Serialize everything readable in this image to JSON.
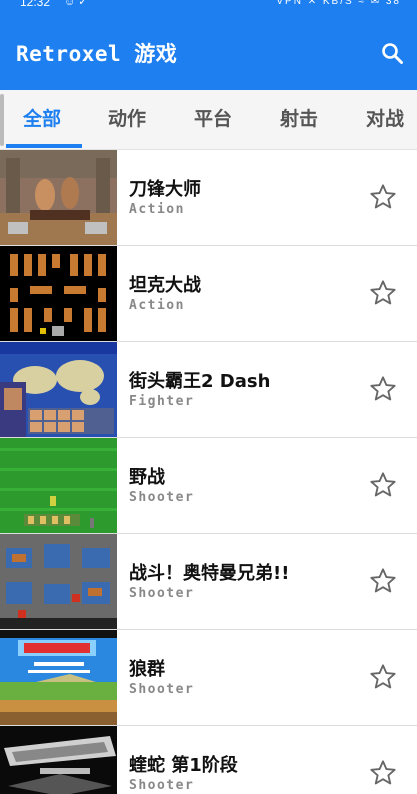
{
  "status_bar": {
    "time": "12:32",
    "right_text": "VPN ✕ KB/S ≈ ✉ 38"
  },
  "app_bar": {
    "title": "Retroxel 游戏"
  },
  "tabs": [
    {
      "label": "全部"
    },
    {
      "label": "动作"
    },
    {
      "label": "平台"
    },
    {
      "label": "射击"
    },
    {
      "label": "对战"
    }
  ],
  "games": [
    {
      "name": "刀锋大师",
      "genre": "Action",
      "thumb": "brown-fight"
    },
    {
      "name": "坦克大战",
      "genre": "Action",
      "thumb": "tank-maze"
    },
    {
      "name": "街头霸王2 Dash",
      "genre": "Fighter",
      "thumb": "world-map"
    },
    {
      "name": "野战",
      "genre": "Shooter",
      "thumb": "green-field"
    },
    {
      "name": "战斗！奥特曼兄弟!!",
      "genre": "Shooter",
      "thumb": "city-map"
    },
    {
      "name": "狼群",
      "genre": "Shooter",
      "thumb": "airwolf"
    },
    {
      "name": "蝰蛇 第1阶段",
      "genre": "Shooter",
      "thumb": "viper"
    }
  ]
}
